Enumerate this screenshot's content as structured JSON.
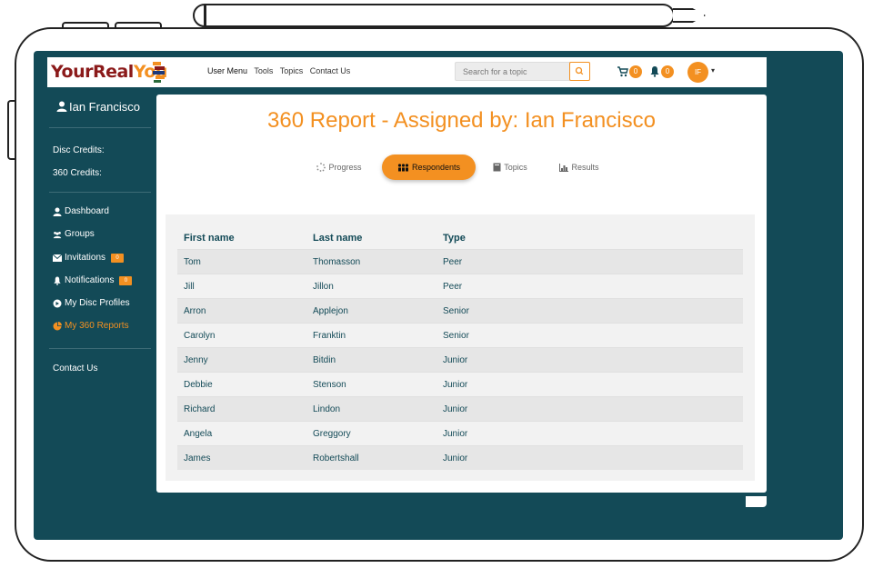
{
  "header": {
    "logo_text_1": "YourReal",
    "logo_text_2": "You",
    "nav": [
      "User Menu",
      "Tools",
      "Topics",
      "Contact Us"
    ],
    "search_placeholder": "Search for a topic",
    "cart_count": "0",
    "bell_count": "0",
    "avatar_initials": "IF"
  },
  "sidebar": {
    "user_name": "Ian Francisco",
    "disc_credits_label": "Disc Credits:",
    "credits_360_label": "360 Credits:",
    "items": [
      {
        "label": "Dashboard",
        "icon": "user-icon"
      },
      {
        "label": "Groups",
        "icon": "users-icon"
      },
      {
        "label": "Invitations",
        "icon": "envelope-icon",
        "badge": "0"
      },
      {
        "label": "Notifications",
        "icon": "bell-icon",
        "badge": "0"
      },
      {
        "label": "My Disc Profiles",
        "icon": "circle-icon"
      },
      {
        "label": "My 360 Reports",
        "icon": "pie-icon",
        "active": true
      }
    ],
    "contact_label": "Contact Us"
  },
  "main": {
    "title": "360 Report - Assigned by: Ian Francisco",
    "tabs": [
      {
        "label": "Progress"
      },
      {
        "label": "Respondents",
        "active": true
      },
      {
        "label": "Topics"
      },
      {
        "label": "Results"
      }
    ],
    "table": {
      "columns": [
        "First name",
        "Last name",
        "Type"
      ],
      "rows": [
        [
          "Tom",
          "Thomasson",
          "Peer"
        ],
        [
          "Jill",
          "Jillon",
          "Peer"
        ],
        [
          "Arron",
          "Applejon",
          "Senior"
        ],
        [
          "Carolyn",
          "Franktin",
          "Senior"
        ],
        [
          "Jenny",
          "Bitdin",
          "Junior"
        ],
        [
          "Debbie",
          "Stenson",
          "Junior"
        ],
        [
          "Richard",
          "Lindon",
          "Junior"
        ],
        [
          "Angela",
          "Greggory",
          "Junior"
        ],
        [
          "James",
          "Robertshall",
          "Junior"
        ]
      ]
    }
  },
  "colors": {
    "accent": "#f39021",
    "dark_teal": "#134a57"
  }
}
